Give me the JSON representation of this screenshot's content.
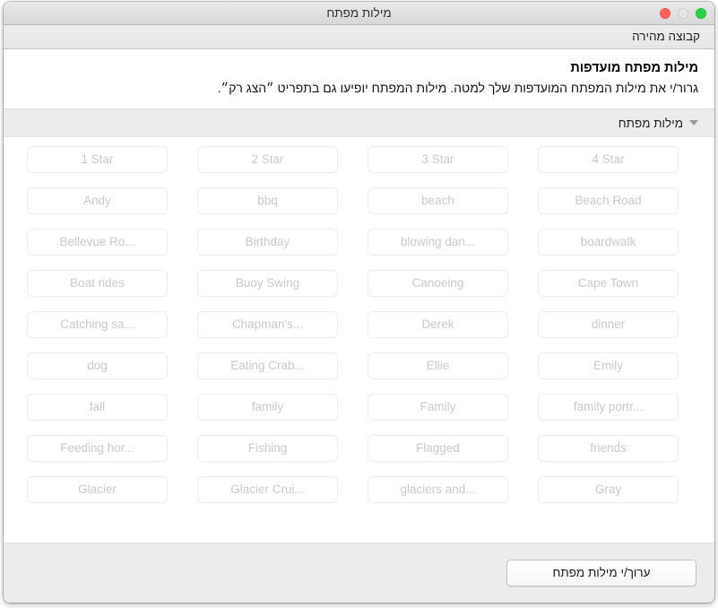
{
  "window": {
    "title": "מילות מפתח",
    "traffic_lights": [
      {
        "name": "close-button",
        "color": "#2ad043",
        "state": "green"
      },
      {
        "name": "minimize-button",
        "color": "#e4e4e4",
        "state": "gray"
      },
      {
        "name": "zoom-button",
        "color": "#fc6058",
        "state": "red"
      }
    ]
  },
  "toolbar": {
    "quick_group_label": "קבוצה מהירה"
  },
  "intro": {
    "title": "מילות מפתח מועדפות",
    "body": "גרור/י את מילות המפתח המועדפות שלך למטה. מילות המפתח יופיעו גם בתפריט ״הצג רק״."
  },
  "section": {
    "title": "מילות מפתח",
    "disclosure_icon": "triangle-down-icon",
    "expanded": true
  },
  "keywords": [
    "1 Star",
    "2 Star",
    "3 Star",
    "4 Star",
    "Andy",
    "bbq",
    "beach",
    "Beach Road",
    "Bellevue Ro...",
    "Birthday",
    "blowing dan...",
    "boardwalk",
    "Boat rides",
    "Buoy Swing",
    "Canoeing",
    "Cape Town",
    "Catching sa...",
    "Chapman's...",
    "Derek",
    "dinner",
    "dog",
    "Eating Crab...",
    "Ellie",
    "Emily",
    "fall",
    "family",
    "Family",
    "family portr...",
    "Feeding hor...",
    "Fishing",
    "Flagged",
    "friends",
    "Glacier",
    "Glacier Crui...",
    "glaciers and...",
    "Gray"
  ],
  "footer": {
    "edit_keywords_label": "ערוך/י מילות מפתח"
  },
  "colors": {
    "titlebar_top": "#e9e9e9",
    "titlebar_bottom": "#d8d8d8",
    "toolbar_bg": "#ededed",
    "section_bar_bg": "#ececec",
    "footer_bg": "#ececec",
    "content_bg": "#ffffff",
    "keyword_text": "#c9c9c9",
    "keyword_border": "#ededed"
  }
}
